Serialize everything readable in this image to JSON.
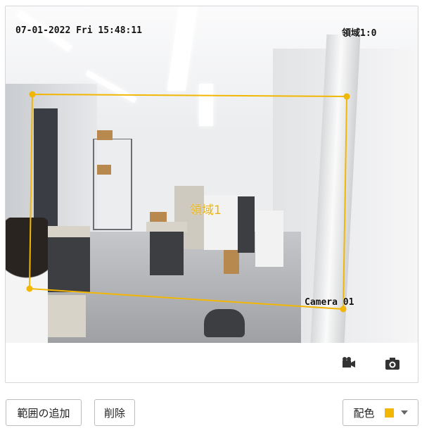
{
  "camera": {
    "timestamp": "07-01-2022 Fri 15:48:11",
    "region_ratio_label": "領域1:0",
    "camera_name": "Camera 01",
    "region_label": "領域1",
    "region_color": "#f2b705"
  },
  "toolbar": {
    "record_icon": "video-camera-icon",
    "snapshot_icon": "camera-icon"
  },
  "actions": {
    "add_region_label": "範囲の追加",
    "delete_label": "削除",
    "color_label": "配色",
    "color_value": "#f2b705"
  }
}
